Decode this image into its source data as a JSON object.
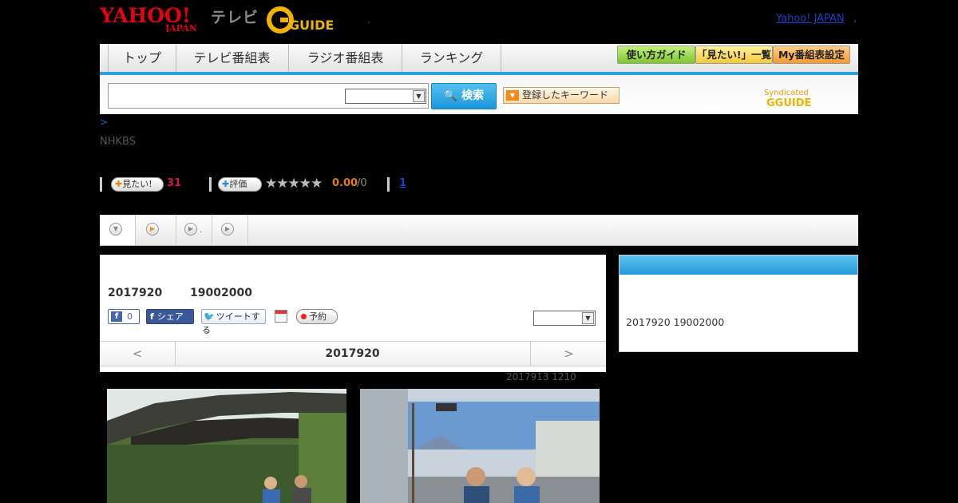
{
  "header": {
    "logo_yahoo": "YAHOO!",
    "logo_japan": "JAPAN",
    "logo_tv": "テレビ",
    "logo_gguide": "GUIDE",
    "yahoo_japan_link": "Yahoo! JAPAN",
    "dot1": ",",
    "dot2": ","
  },
  "nav": {
    "tabs": [
      "トップ",
      "テレビ番組表",
      "ラジオ番組表",
      "ランキング"
    ],
    "buttons": [
      "使い方ガイド",
      "「見たい!」一覧",
      "My番組表設定"
    ]
  },
  "search": {
    "button_label": "検索",
    "keyword_button": "登録したキーワード",
    "syndicated_label": "Syndicated"
  },
  "breadcrumb": ">",
  "channel": "NHKBS",
  "stats": {
    "miitai_label": "見たい!",
    "miitai_count": "31",
    "rating_label": "評価",
    "stars": "★★★★★",
    "rating_value": "0.00",
    "rating_total": "/0",
    "review_count": "1"
  },
  "tabs": {
    "tab2_suffix": "."
  },
  "program": {
    "date": "2017920",
    "time": "19002000",
    "fb_like_count": "0",
    "fb_share_label": "シェア",
    "tweet_label": "ツイートする",
    "reserve_label": "予約",
    "date_prev": "<",
    "date_current": "2017920",
    "date_next": ">",
    "rebroadcast": "2017913  1210"
  },
  "side": {
    "datetime": "2017920  19002000"
  },
  "colors": {
    "nav_accent": "#2aa0dc",
    "miitai_count": "#d3174e",
    "rating_value": "#e17b1d",
    "side_header": "#2399d8"
  }
}
